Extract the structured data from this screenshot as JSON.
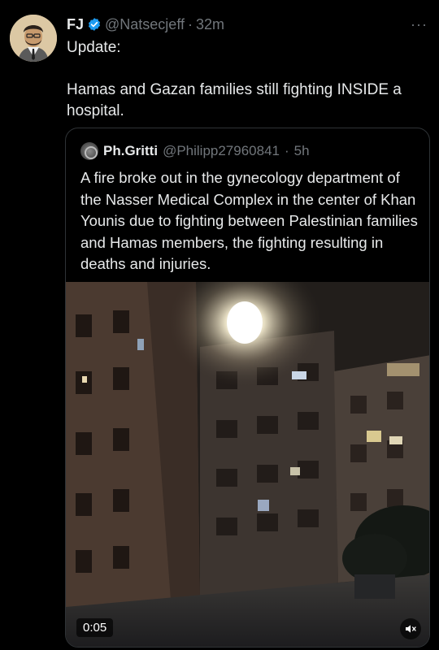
{
  "tweet": {
    "author_name": "FJ",
    "author_handle": "@Natsecjeff",
    "time": "32m",
    "text": "Update:\n\nHamas and Gazan families still fighting INSIDE a hospital.",
    "more_label": "···"
  },
  "quote": {
    "author_name": "Ph.Gritti",
    "author_handle": "@Philipp27960841",
    "time": "5h",
    "text": "A fire broke out in the gynecology department of the Nasser Medical Complex in the center of Khan Younis due to fighting between Palestinian families and Hamas members, the fighting resulting in deaths and injuries."
  },
  "video": {
    "duration": "0:05"
  },
  "colors": {
    "background": "#000000",
    "text": "#e7e9ea",
    "muted": "#71767b",
    "verified": "#1d9bf0",
    "border": "#2f3336"
  },
  "icons": {
    "verified": "verified-badge-icon",
    "more": "more-dots-icon",
    "mute": "speaker-muted-icon"
  }
}
